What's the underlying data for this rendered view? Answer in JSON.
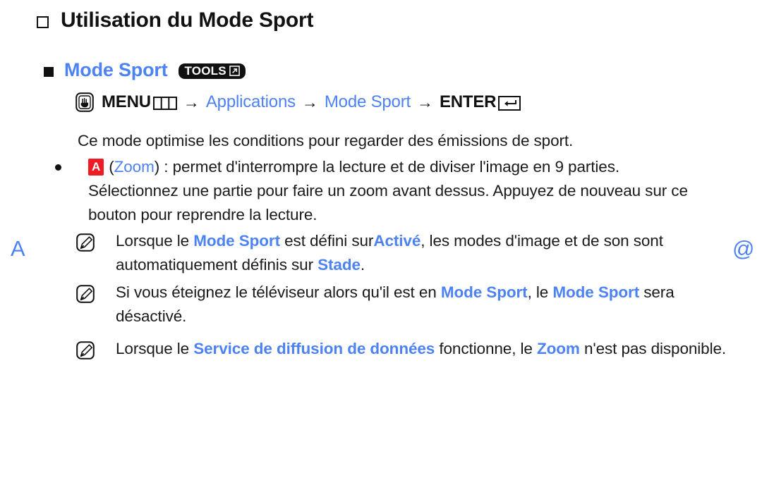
{
  "colors": {
    "accent_blue": "#4d82f3",
    "badge_red": "#ee1c25",
    "text_black": "#1a1a1a",
    "badge_black": "#111111"
  },
  "margin_marks": {
    "left": "A",
    "right": "@"
  },
  "heading": {
    "bullet_icon": "square-outline-icon",
    "text": "Utilisation du Mode Sport"
  },
  "subheading": {
    "bullet_icon": "square-filled-icon",
    "text": "Mode Sport",
    "badge": {
      "label": "TOOLS",
      "icon": "arrow-out-box-icon"
    }
  },
  "nav_path": {
    "lead_icon": "hand-press-button-icon",
    "segments": [
      {
        "label": "MENU",
        "style": "bold-black",
        "glyph": "menu-grid-icon"
      },
      {
        "label": "→",
        "style": "arrow"
      },
      {
        "label": "Applications",
        "style": "blue"
      },
      {
        "label": "→",
        "style": "arrow"
      },
      {
        "label": "Mode Sport",
        "style": "blue"
      },
      {
        "label": "→",
        "style": "arrow"
      },
      {
        "label": "ENTER",
        "style": "bold-black",
        "glyph": "enter-return-icon"
      }
    ]
  },
  "intro_paragraph": "Ce mode optimise les conditions pour regarder des émissions de sport.",
  "bullet": {
    "marker_icon": "dot-bullet-icon",
    "key_badge": "A",
    "key_name": "Zoom",
    "text_open_paren": "(",
    "text_close_paren": ")",
    "text_after": " : permet d'interrompre la lecture et de diviser l'image en 9 parties. Sélectionnez une partie pour faire un zoom avant dessus. Appuyez de nouveau sur ce bouton pour reprendre la lecture."
  },
  "notes": [
    {
      "icon": "note-pencil-icon",
      "parts": [
        {
          "t": "Lorsque le ",
          "s": "plain"
        },
        {
          "t": "Mode Sport",
          "s": "blue-bold"
        },
        {
          "t": " est défini sur",
          "s": "plain"
        },
        {
          "t": "Activé",
          "s": "blue-bold"
        },
        {
          "t": ", les modes d'image et de son sont automatiquement définis sur ",
          "s": "plain"
        },
        {
          "t": "Stade",
          "s": "blue-bold"
        },
        {
          "t": ".",
          "s": "plain"
        }
      ]
    },
    {
      "icon": "note-pencil-icon",
      "parts": [
        {
          "t": "Si vous éteignez le téléviseur alors qu'il est en ",
          "s": "plain"
        },
        {
          "t": "Mode Sport",
          "s": "blue-bold"
        },
        {
          "t": ", le ",
          "s": "plain"
        },
        {
          "t": "Mode Sport",
          "s": "blue-bold"
        },
        {
          "t": " sera désactivé.",
          "s": "plain"
        }
      ]
    },
    {
      "icon": "note-pencil-icon",
      "parts": [
        {
          "t": "Lorsque le ",
          "s": "plain"
        },
        {
          "t": "Service de diffusion de données",
          "s": "blue-bold"
        },
        {
          "t": " fonctionne, le ",
          "s": "plain"
        },
        {
          "t": "Zoom",
          "s": "blue-bold"
        },
        {
          "t": " n'est pas disponible.",
          "s": "plain"
        }
      ]
    }
  ]
}
